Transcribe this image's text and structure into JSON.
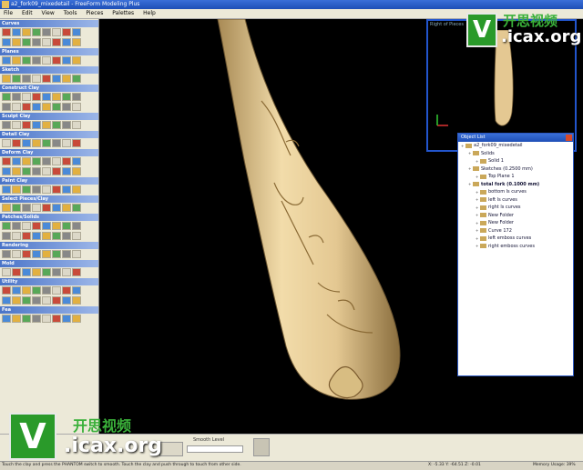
{
  "window": {
    "title": "a2_fork09_mixedetail - FreeForm Modeling Plus"
  },
  "menu": [
    "File",
    "Edit",
    "View",
    "Tools",
    "Pieces",
    "Palettes",
    "Help"
  ],
  "panel_sections": [
    "Curves",
    "Planes",
    "Sketch",
    "Construct Clay",
    "Sculpt Clay",
    "Detail Clay",
    "Deform Clay",
    "Paint Clay",
    "Select Pieces/Clay",
    "Patches/Solids",
    "Rendering",
    "Mold",
    "Utility",
    "Fea"
  ],
  "mini_view": {
    "label": "Right of Pieces"
  },
  "object_list": {
    "title": "Object List",
    "items": [
      {
        "label": "a2_fork09_mixedetail",
        "indent": 0
      },
      {
        "label": "Solids",
        "indent": 1
      },
      {
        "label": "Solid 1",
        "indent": 2
      },
      {
        "label": "Sketches (0.2500 mm)",
        "indent": 1
      },
      {
        "label": "Top Plane 1",
        "indent": 2
      },
      {
        "label": "total fork (0.1000 mm)",
        "indent": 1
      },
      {
        "label": "bottom ls curves",
        "indent": 2
      },
      {
        "label": "left ls curves",
        "indent": 2
      },
      {
        "label": "right ls curves",
        "indent": 2
      },
      {
        "label": "New Folder",
        "indent": 2
      },
      {
        "label": "New Folder",
        "indent": 2
      },
      {
        "label": "Curve 172",
        "indent": 2
      },
      {
        "label": "left emboss curves",
        "indent": 2
      },
      {
        "label": "right emboss curves",
        "indent": 2
      }
    ]
  },
  "bottom_bar": {
    "smooth_label": "Smooth Level"
  },
  "status": {
    "message": "Touch the clay and press the PHANTOM switch to smooth. Touch the clay and push through to touch from other side.",
    "coords": "X: -5.33   Y: -64.51   Z: -0.01",
    "memory": "Memory Usage: 39%"
  },
  "watermark": {
    "cn": "开思视频",
    "url": ".icax.org",
    "logo": "V"
  },
  "colors": {
    "background": "#000000",
    "fork": "#e6cf9a",
    "panel": "#ece9d8",
    "title_bar": "#1e4fb6"
  }
}
